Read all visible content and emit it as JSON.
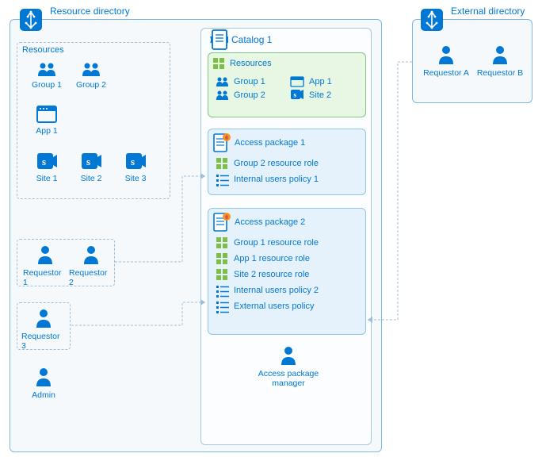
{
  "resourceDir": {
    "title": "Resource directory",
    "resourcesLabel": "Resources",
    "groups": [
      "Group 1",
      "Group 2"
    ],
    "apps": [
      "App 1"
    ],
    "sites": [
      "Site 1",
      "Site 2",
      "Site 3"
    ],
    "requestors": [
      "Requestor 1",
      "Requestor 2",
      "Requestor 3"
    ],
    "admin": "Admin"
  },
  "catalog": {
    "title": "Catalog 1",
    "resources": {
      "label": "Resources",
      "items": {
        "group1": "Group 1",
        "group2": "Group 2",
        "app1": "App 1",
        "site2": "Site 2"
      }
    },
    "pkg1": {
      "title": "Access package 1",
      "roles": [
        "Group 2 resource role"
      ],
      "policies": [
        "Internal users policy 1"
      ]
    },
    "pkg2": {
      "title": "Access package 2",
      "roles": [
        "Group 1 resource role",
        "App 1 resource role",
        "Site 2 resource role"
      ],
      "policies": [
        "Internal users policy 2",
        "External users policy"
      ]
    },
    "manager": "Access package\nmanager"
  },
  "externalDir": {
    "title": "External directory",
    "requestors": [
      "Requestor A",
      "Requestor B"
    ]
  }
}
